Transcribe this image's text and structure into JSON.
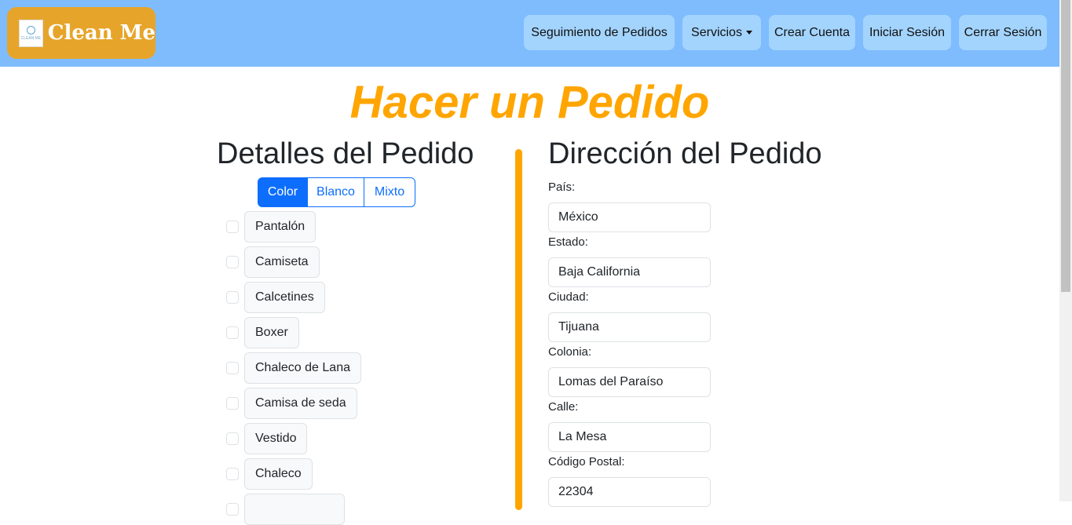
{
  "header": {
    "brand_name": "Clean Me",
    "logo_text": "CLEAN ME",
    "nav": [
      {
        "label": "Seguimiento de Pedidos"
      },
      {
        "label": "Servicios"
      },
      {
        "label": "Crear Cuenta"
      },
      {
        "label": "Iniciar Sesión"
      },
      {
        "label": "Cerrar Sesión"
      }
    ]
  },
  "page": {
    "title": "Hacer un Pedido"
  },
  "details": {
    "title": "Detalles del Pedido",
    "toggle": [
      {
        "label": "Color",
        "active": true
      },
      {
        "label": "Blanco",
        "active": false
      },
      {
        "label": "Mixto",
        "active": false
      }
    ],
    "items": [
      {
        "label": "Pantalón",
        "checked": false
      },
      {
        "label": "Camiseta",
        "checked": false
      },
      {
        "label": "Calcetines",
        "checked": false
      },
      {
        "label": "Boxer",
        "checked": false
      },
      {
        "label": "Chaleco de Lana",
        "checked": false
      },
      {
        "label": "Camisa de seda",
        "checked": false
      },
      {
        "label": "Vestido",
        "checked": false
      },
      {
        "label": "Chaleco",
        "checked": false
      },
      {
        "label": "",
        "checked": false
      }
    ]
  },
  "address": {
    "title": "Dirección del Pedido",
    "fields": [
      {
        "label": "País:",
        "value": "México"
      },
      {
        "label": "Estado:",
        "value": "Baja California"
      },
      {
        "label": "Ciudad:",
        "value": "Tijuana"
      },
      {
        "label": "Colonia:",
        "value": "Lomas del Paraíso"
      },
      {
        "label": "Calle:",
        "value": "La Mesa"
      },
      {
        "label": "Código Postal:",
        "value": "22304"
      }
    ]
  },
  "colors": {
    "navbar": "#7fbcfd",
    "nav_button": "#a3d4fe",
    "brand_bg": "#e6a52a",
    "accent_orange": "#ffa500",
    "primary_blue": "#0d6efd"
  }
}
